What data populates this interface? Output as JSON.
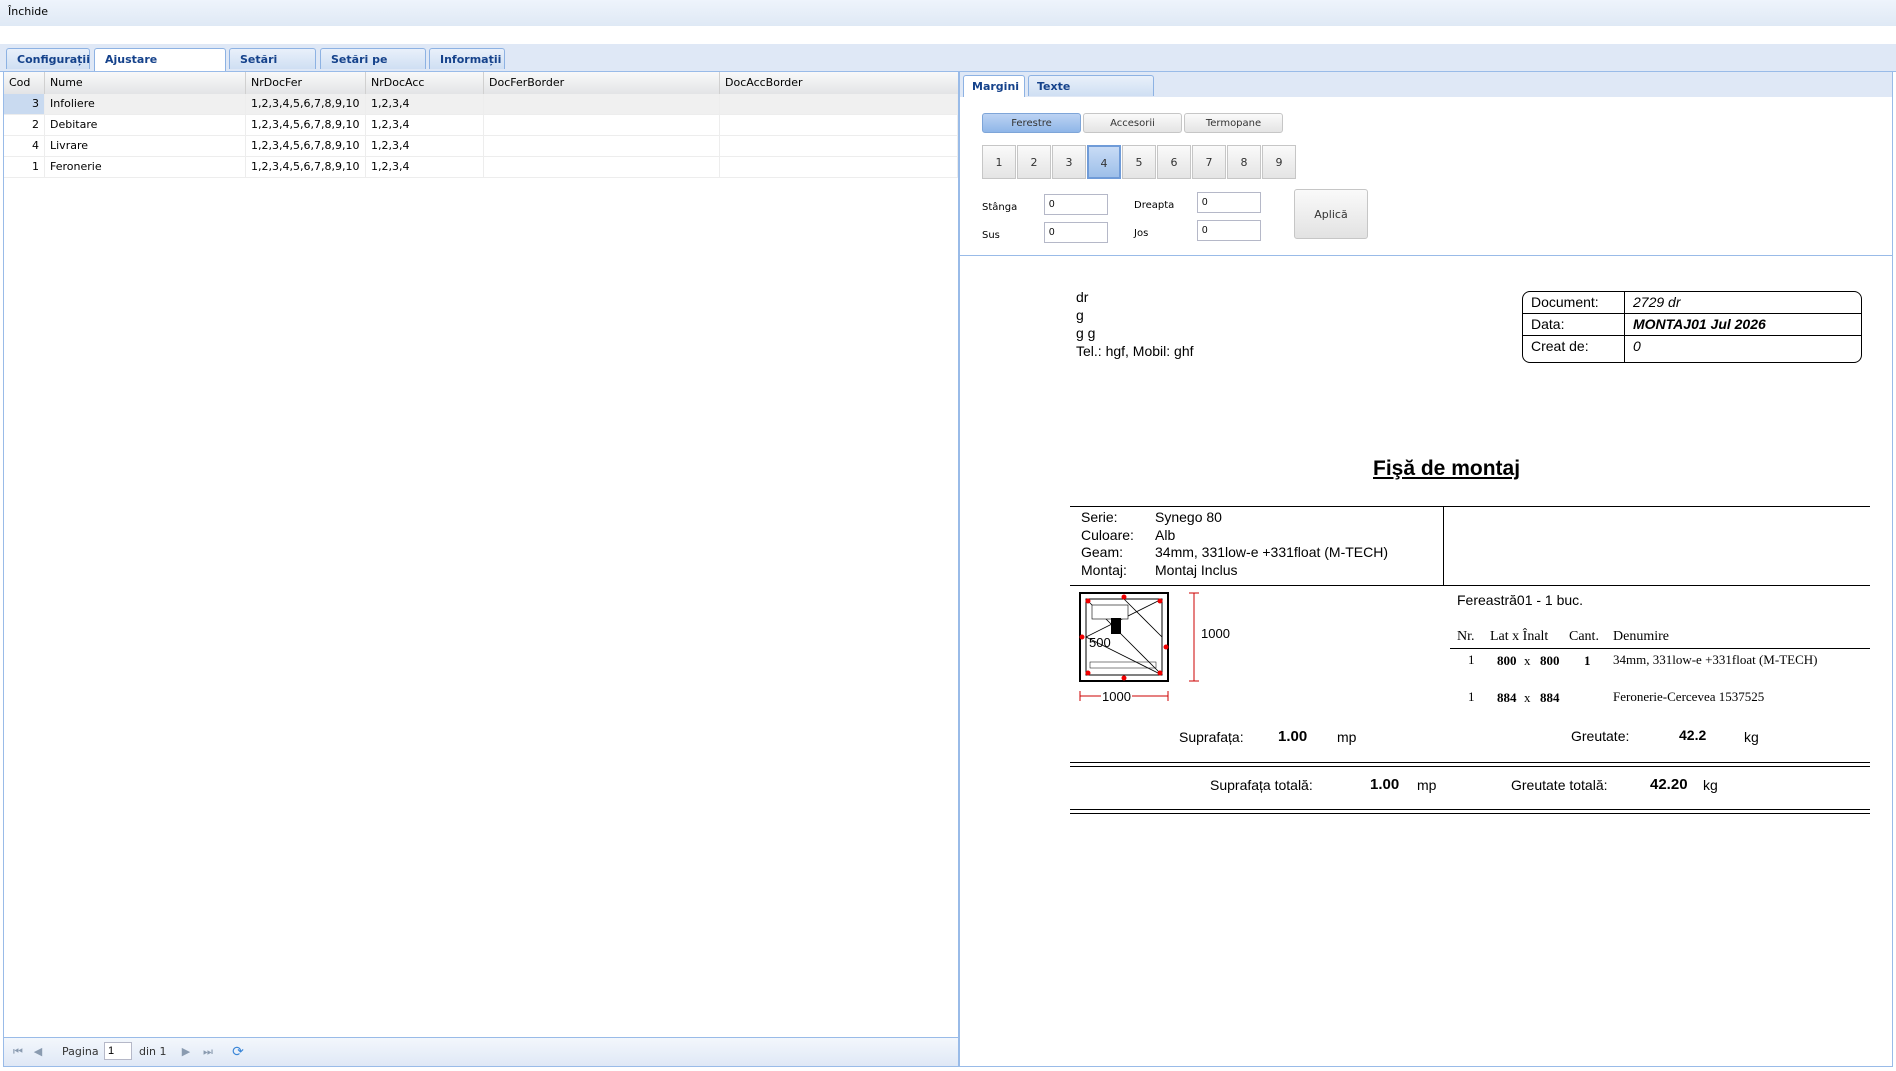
{
  "toolbar": {
    "close_label": "Închide"
  },
  "tabs": [
    {
      "label": "Configurații",
      "active": false
    },
    {
      "label": "Ajustare documente",
      "active": true
    },
    {
      "label": "Setări locale",
      "active": false
    },
    {
      "label": "Setări pe server",
      "active": false
    },
    {
      "label": "Informații",
      "active": false
    }
  ],
  "grid": {
    "columns": [
      "Cod",
      "Nume",
      "NrDocFer",
      "NrDocAcc",
      "DocFerBorder",
      "DocAccBorder"
    ],
    "rows": [
      {
        "cod": "3",
        "nume": "Infoliere",
        "nrdocfer": "1,2,3,4,5,6,7,8,9,10",
        "nrdocacc": "1,2,3,4",
        "docferborder": "",
        "docaccborder": "",
        "selected": true
      },
      {
        "cod": "2",
        "nume": "Debitare",
        "nrdocfer": "1,2,3,4,5,6,7,8,9,10",
        "nrdocacc": "1,2,3,4",
        "docferborder": "",
        "docaccborder": "",
        "selected": false
      },
      {
        "cod": "4",
        "nume": "Livrare",
        "nrdocfer": "1,2,3,4,5,6,7,8,9,10",
        "nrdocacc": "1,2,3,4",
        "docferborder": "",
        "docaccborder": "",
        "selected": false
      },
      {
        "cod": "1",
        "nume": "Feronerie",
        "nrdocfer": "1,2,3,4,5,6,7,8,9,10",
        "nrdocacc": "1,2,3,4",
        "docferborder": "",
        "docaccborder": "",
        "selected": false
      }
    ]
  },
  "pager": {
    "label": "Pagina",
    "current": "1",
    "of": "din 1"
  },
  "right": {
    "subtabs": [
      {
        "label": "Margini",
        "active": true
      },
      {
        "label": "Texte suplimentare",
        "active": false
      }
    ],
    "segments": [
      {
        "label": "Ferestre",
        "active": true
      },
      {
        "label": "Accesorii",
        "active": false
      },
      {
        "label": "Termopane",
        "active": false
      }
    ],
    "numbers": [
      "1",
      "2",
      "3",
      "4",
      "5",
      "6",
      "7",
      "8",
      "9"
    ],
    "active_number": "4",
    "fields": {
      "stanga_label": "Stânga",
      "stanga_value": "0",
      "dreapta_label": "Dreapta",
      "dreapta_value": "0",
      "sus_label": "Sus",
      "sus_value": "0",
      "jos_label": "Jos",
      "jos_value": "0"
    },
    "apply_label": "Aplică"
  },
  "doc": {
    "address_lines": [
      "dr",
      "g",
      "g g",
      "Tel.: hgf, Mobil: ghf"
    ],
    "info": [
      {
        "label": "Document:",
        "value": "2729 dr"
      },
      {
        "label": "Data:",
        "value": "MONTAJ01 Jul 2026"
      },
      {
        "label": "Creat de:",
        "value": "0"
      }
    ],
    "title": "Fişă de montaj",
    "specs": [
      {
        "label": "Serie:",
        "value": "Synego 80"
      },
      {
        "label": "Culoare:",
        "value": "Alb"
      },
      {
        "label": "Geam:",
        "value": "34mm, 331low-e +331float (M-TECH)"
      },
      {
        "label": "Montaj:",
        "value": "Montaj Inclus"
      }
    ],
    "item_title": "Fereastră01 - 1 buc.",
    "drawing": {
      "height_dim": "1000",
      "width_dim": "1000",
      "inner_dim": "500"
    },
    "table_headers": {
      "nr": "Nr.",
      "latinalt": "Lat x Înalt",
      "cant": "Cant.",
      "denumire": "Denumire"
    },
    "table_rows": [
      {
        "nr": "1",
        "lat": "800",
        "x": "x",
        "inalt": "800",
        "cant": "1",
        "denumire": "34mm, 331low-e +331float (M-TECH)"
      },
      {
        "nr": "1",
        "lat": "884",
        "x": "x",
        "inalt": "884",
        "cant": "",
        "denumire": "Feronerie-Cercevea 1537525"
      }
    ],
    "suprafata_label": "Suprafața:",
    "suprafata_value": "1.00",
    "suprafata_unit": "mp",
    "greutate_label": "Greutate:",
    "greutate_value": "42.2",
    "greutate_unit": "kg",
    "total_suprafata_label": "Suprafața totală:",
    "total_suprafata_value": "1.00",
    "total_suprafata_unit": "mp",
    "total_greutate_label": "Greutate totală:",
    "total_greutate_value": "42.20",
    "total_greutate_unit": "kg"
  }
}
